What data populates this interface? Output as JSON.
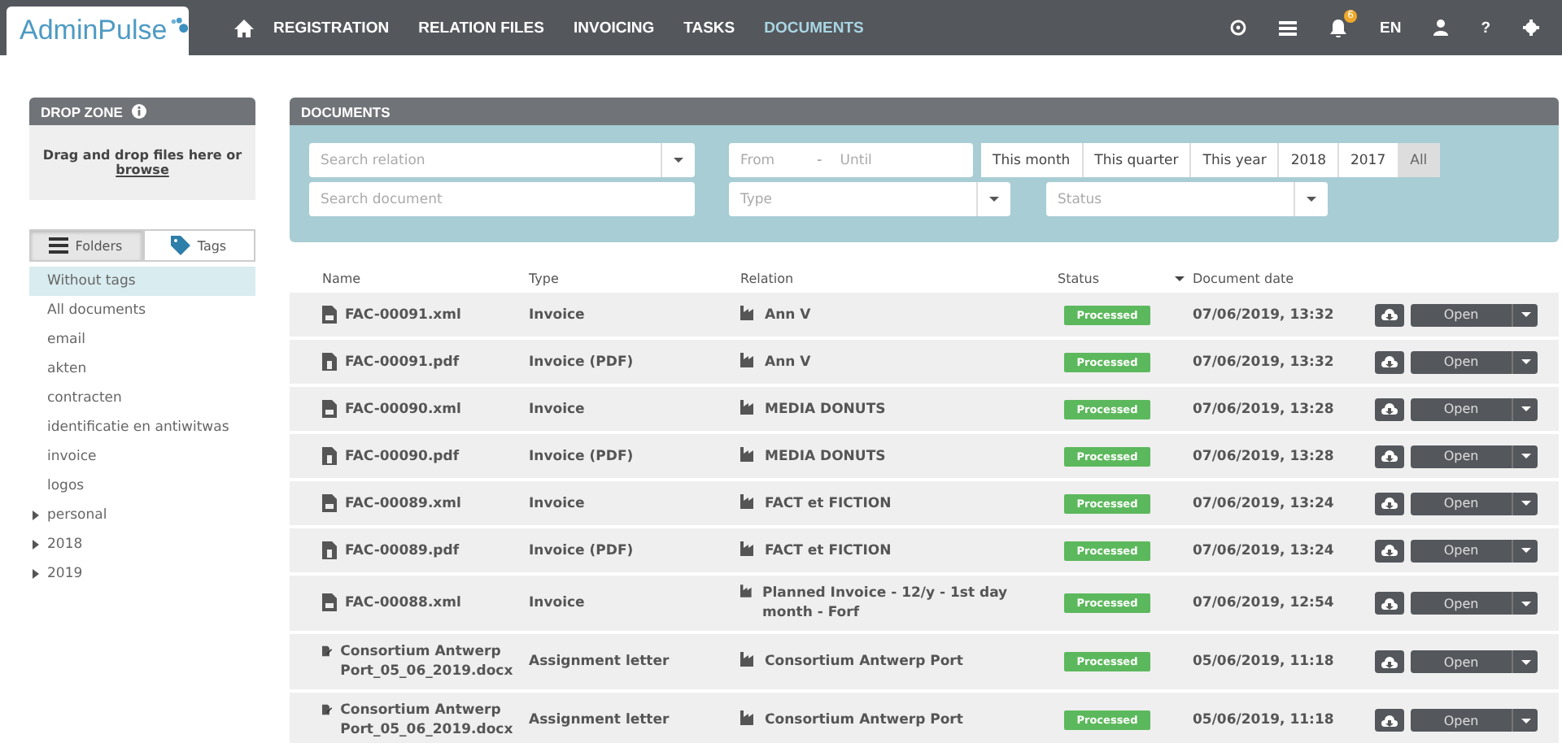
{
  "navbar": {
    "logo": "AdminPulse",
    "items": [
      {
        "label": "REGISTRATION",
        "selected": false
      },
      {
        "label": "RELATION FILES",
        "selected": false
      },
      {
        "label": "INVOICING",
        "selected": false
      },
      {
        "label": "TASKS",
        "selected": false
      },
      {
        "label": "DOCUMENTS",
        "selected": true
      }
    ],
    "notification_count": "6",
    "language": "EN",
    "help": "?"
  },
  "drop_zone": {
    "title": "DROP ZONE",
    "text": "Drag and drop files here or",
    "link": "browse"
  },
  "view_toggle": [
    {
      "label": "Folders",
      "kind": "folders",
      "selected": true
    },
    {
      "label": "Tags",
      "kind": "tags",
      "selected": false
    }
  ],
  "folders": [
    {
      "label": "Without tags",
      "selected": true
    },
    {
      "label": "All documents",
      "selected": false
    },
    {
      "label": "email",
      "selected": false
    },
    {
      "label": "akten",
      "selected": false
    },
    {
      "label": "contracten",
      "selected": false
    },
    {
      "label": "identificatie en antiwitwas",
      "selected": false
    },
    {
      "label": "invoice",
      "selected": false
    },
    {
      "label": "logos",
      "selected": false
    },
    {
      "label": "personal",
      "selected": false,
      "expanded": false
    },
    {
      "label": "2018",
      "selected": false,
      "expanded": false
    },
    {
      "label": "2019",
      "selected": false,
      "expanded": false
    }
  ],
  "documents": {
    "title": "DOCUMENTS",
    "filters": {
      "relation_placeholder": "Search relation",
      "document_placeholder": "Search document",
      "from_placeholder": "From",
      "range_separator": "-",
      "until_placeholder": "Until",
      "type_placeholder": "Type",
      "status_placeholder": "Status",
      "periods": [
        {
          "label": "This month",
          "selected": false
        },
        {
          "label": "This quarter",
          "selected": false
        },
        {
          "label": "This year",
          "selected": false
        },
        {
          "label": "2018",
          "selected": false
        },
        {
          "label": "2017",
          "selected": false
        },
        {
          "label": "All",
          "selected": true
        }
      ]
    },
    "columns": [
      "Name",
      "Type",
      "Relation",
      "Status",
      "Document date"
    ],
    "rows": [
      {
        "name": "FAC-00091.xml",
        "kind": "xml",
        "type": "Invoice",
        "relation": "Ann V",
        "status": "Processed",
        "date": "07/06/2019, 13:32",
        "action": "Open"
      },
      {
        "name": "FAC-00091.pdf",
        "kind": "pdf",
        "type": "Invoice (PDF)",
        "relation": "Ann V",
        "status": "Processed",
        "date": "07/06/2019, 13:32",
        "action": "Open"
      },
      {
        "name": "FAC-00090.xml",
        "kind": "xml",
        "type": "Invoice",
        "relation": "MEDIA DONUTS",
        "status": "Processed",
        "date": "07/06/2019, 13:28",
        "action": "Open"
      },
      {
        "name": "FAC-00090.pdf",
        "kind": "pdf",
        "type": "Invoice (PDF)",
        "relation": "MEDIA DONUTS",
        "status": "Processed",
        "date": "07/06/2019, 13:28",
        "action": "Open"
      },
      {
        "name": "FAC-00089.xml",
        "kind": "xml",
        "type": "Invoice",
        "relation": "FACT et FICTION",
        "status": "Processed",
        "date": "07/06/2019, 13:24",
        "action": "Open"
      },
      {
        "name": "FAC-00089.pdf",
        "kind": "pdf",
        "type": "Invoice (PDF)",
        "relation": "FACT et FICTION",
        "status": "Processed",
        "date": "07/06/2019, 13:24",
        "action": "Open"
      },
      {
        "name": "FAC-00088.xml",
        "kind": "xml",
        "type": "Invoice",
        "relation": "Planned Invoice - 12/y - 1st day month - Forf",
        "status": "Processed",
        "date": "07/06/2019, 12:54",
        "action": "Open"
      },
      {
        "name": "Consortium Antwerp Port_05_06_2019.docx",
        "kind": "docx",
        "type": "Assignment letter",
        "relation": "Consortium Antwerp Port",
        "status": "Processed",
        "date": "05/06/2019, 11:18",
        "action": "Open"
      },
      {
        "name": "Consortium Antwerp Port_05_06_2019.docx",
        "kind": "docx",
        "type": "Assignment letter",
        "relation": "Consortium Antwerp Port",
        "status": "Processed",
        "date": "05/06/2019, 11:18",
        "action": "Open"
      }
    ]
  }
}
